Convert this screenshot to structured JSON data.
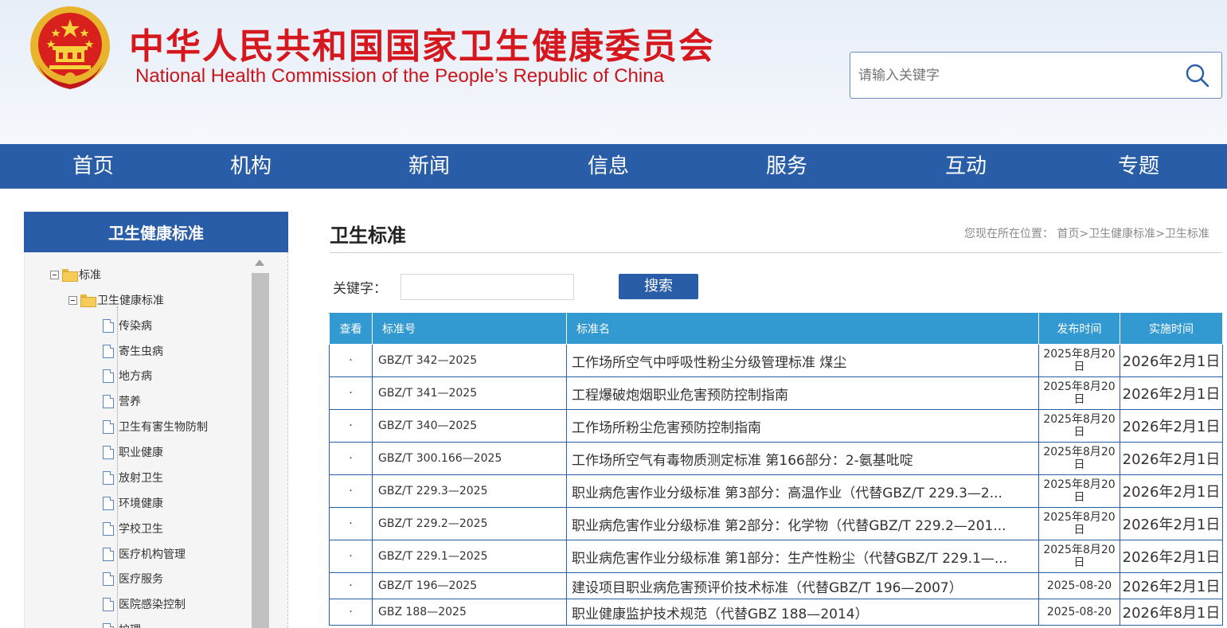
{
  "header": {
    "title_cn": "中华人民共和国国家卫生健康委员会",
    "title_en": "National Health Commission of the People’s  Republic of China",
    "search_placeholder": "请输入关键字"
  },
  "nav": {
    "items": [
      "首页",
      "机构",
      "新闻",
      "信息",
      "服务",
      "互动",
      "专题"
    ]
  },
  "sidebar": {
    "title": "卫生健康标准",
    "tree": {
      "root": "标准",
      "child": "卫生健康标准",
      "leaves": [
        "传染病",
        "寄生虫病",
        "地方病",
        "营养",
        "卫生有害生物防制",
        "职业健康",
        "放射卫生",
        "环境健康",
        "学校卫生",
        "医疗机构管理",
        "医疗服务",
        "医院感染控制",
        "护理"
      ]
    }
  },
  "main": {
    "title": "卫生标准",
    "breadcrumb": {
      "prefix": "您现在所在位置：",
      "items": [
        "首页",
        "卫生健康标准",
        "卫生标准"
      ],
      "sep": ">"
    },
    "keyword_label": "关键字：",
    "search_button": "搜索"
  },
  "table": {
    "headers": [
      "查看",
      "标准号",
      "标准名",
      "发布时间",
      "实施时间"
    ],
    "rows": [
      {
        "view": "·",
        "code": "GBZ/T 342—2025",
        "name": "工作场所空气中呼吸性粉尘分级管理标准 煤尘",
        "published": "2025年8月20日",
        "effective": "2026年2月1日"
      },
      {
        "view": "·",
        "code": "GBZ/T 341—2025",
        "name": "工程爆破炮烟职业危害预防控制指南",
        "published": "2025年8月20日",
        "effective": "2026年2月1日"
      },
      {
        "view": "·",
        "code": "GBZ/T 340—2025",
        "name": "工作场所粉尘危害预防控制指南",
        "published": "2025年8月20日",
        "effective": "2026年2月1日"
      },
      {
        "view": "·",
        "code": "GBZ/T 300.166—2025",
        "name": "工作场所空气有毒物质测定标准 第166部分：2-氨基吡啶",
        "published": "2025年8月20日",
        "effective": "2026年2月1日"
      },
      {
        "view": "·",
        "code": "GBZ/T 229.3—2025",
        "name": "职业病危害作业分级标准 第3部分：高温作业（代替GBZ/T 229.3—2...",
        "published": "2025年8月20日",
        "effective": "2026年2月1日"
      },
      {
        "view": "·",
        "code": "GBZ/T 229.2—2025",
        "name": "职业病危害作业分级标准 第2部分：化学物（代替GBZ/T 229.2—201...",
        "published": "2025年8月20日",
        "effective": "2026年2月1日"
      },
      {
        "view": "·",
        "code": "GBZ/T 229.1—2025",
        "name": "职业病危害作业分级标准 第1部分：生产性粉尘（代替GBZ/T 229.1—...",
        "published": "2025年8月20日",
        "effective": "2026年2月1日"
      },
      {
        "view": "·",
        "code": "GBZ/T 196—2025",
        "name": "建设项目职业病危害预评价技术标准（代替GBZ/T 196—2007）",
        "published": "2025-08-20",
        "effective": "2026年2月1日"
      },
      {
        "view": "·",
        "code": "GBZ 188—2025",
        "name": "职业健康监护技术规范（代替GBZ 188—2014）",
        "published": "2025-08-20",
        "effective": "2026年8月1日"
      }
    ]
  },
  "colors": {
    "brand_red": "#d7171e",
    "nav_blue": "#2a5da8",
    "table_header_blue": "#3299d1"
  }
}
